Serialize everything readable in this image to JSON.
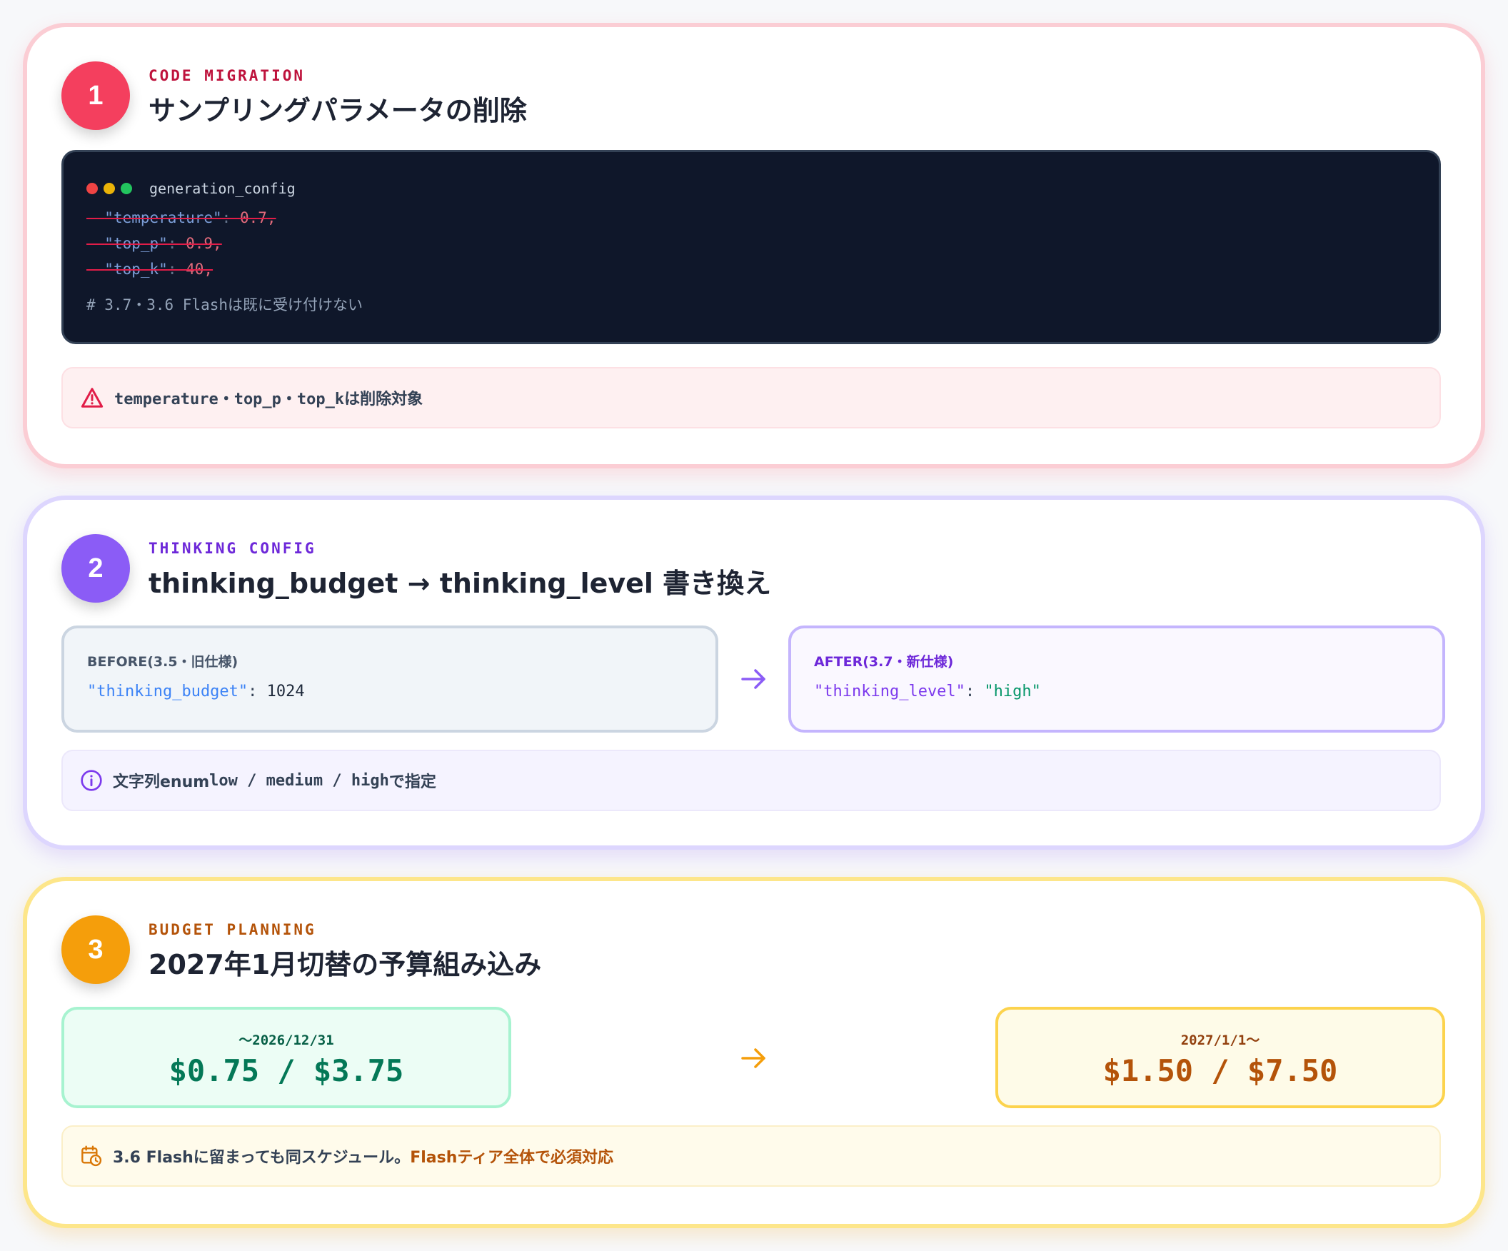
{
  "colors": {
    "step1": "#f43f5e",
    "step2": "#8b5cf6",
    "step3": "#f59e0b",
    "code_bg": "#0f172a"
  },
  "steps": [
    {
      "number": "1",
      "eyebrow": "CODE MIGRATION",
      "title": "サンプリングパラメータの削除",
      "code": {
        "filename": "generation_config",
        "deleted_lines": [
          {
            "prefix": "- ",
            "key": "\"temperature\"",
            "sep": ": ",
            "value": "0.7,"
          },
          {
            "prefix": "- ",
            "key": "\"top_p\"",
            "sep": ": ",
            "value": "0.9,"
          },
          {
            "prefix": "- ",
            "key": "\"top_k\"",
            "sep": ": ",
            "value": "40,"
          }
        ],
        "comment": "# 3.7・3.6 Flashは既に受け付けない"
      },
      "note": {
        "icon": "warning-icon",
        "code_text": "temperature・top_p・top_k",
        "text": "は削除対象"
      }
    },
    {
      "number": "2",
      "eyebrow": "THINKING CONFIG",
      "title": "thinking_budget → thinking_level 書き換え",
      "before": {
        "label": "BEFORE(3.5・旧仕様)",
        "key": "\"thinking_budget\"",
        "sep": ": ",
        "value": "1024"
      },
      "after": {
        "label": "AFTER(3.7・新仕様)",
        "key": "\"thinking_level\"",
        "sep": ": ",
        "value": "\"high\""
      },
      "note": {
        "icon": "info-icon",
        "prefix": "文字列enum ",
        "code_text": "low / medium / high",
        "suffix": " で指定"
      }
    },
    {
      "number": "3",
      "eyebrow": "BUDGET PLANNING",
      "title": "2027年1月切替の予算組み込み",
      "old_price": {
        "date": "〜2026/12/31",
        "amount": "$0.75 / $3.75"
      },
      "new_price": {
        "date": "2027/1/1〜",
        "amount": "$1.50 / $7.50"
      },
      "note": {
        "icon": "calendar-clock-icon",
        "text": "3.6 Flashに留まっても同スケジュール。",
        "highlight": "Flashティア全体で必須対応"
      }
    }
  ]
}
